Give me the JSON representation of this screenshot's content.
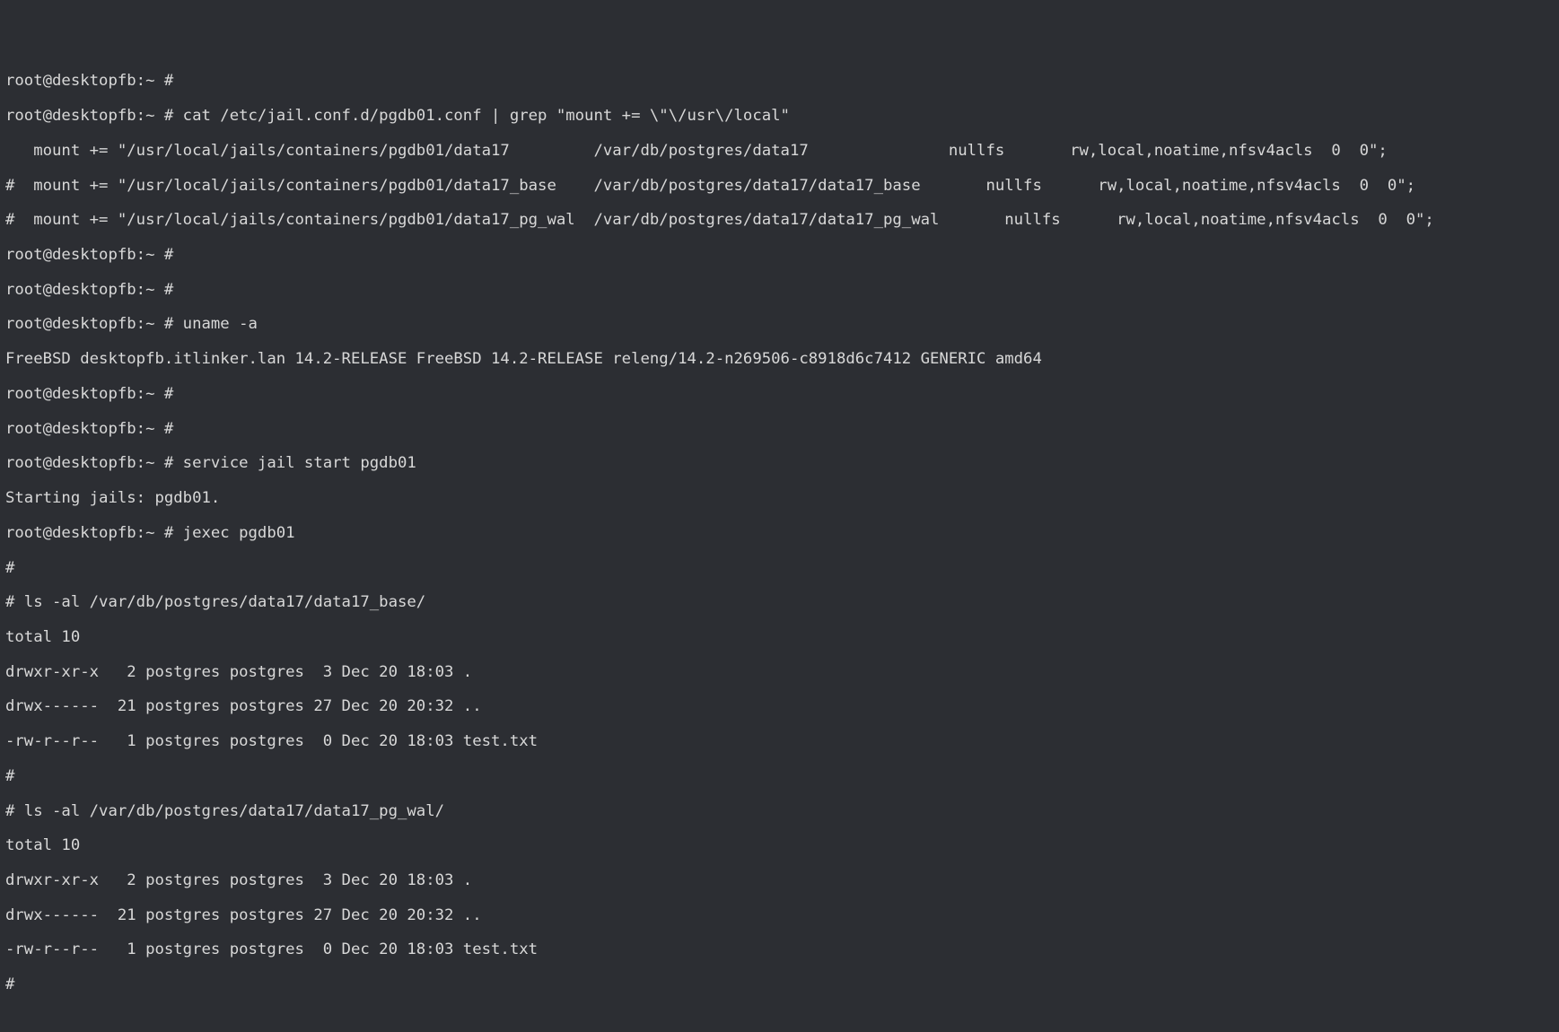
{
  "lines": [
    "root@desktopfb:~ #",
    "root@desktopfb:~ # cat /etc/jail.conf.d/pgdb01.conf | grep \"mount += \\\"\\/usr\\/local\"",
    "   mount += \"/usr/local/jails/containers/pgdb01/data17         /var/db/postgres/data17               nullfs       rw,local,noatime,nfsv4acls  0  0\";",
    "#  mount += \"/usr/local/jails/containers/pgdb01/data17_base    /var/db/postgres/data17/data17_base       nullfs      rw,local,noatime,nfsv4acls  0  0\";",
    "#  mount += \"/usr/local/jails/containers/pgdb01/data17_pg_wal  /var/db/postgres/data17/data17_pg_wal       nullfs      rw,local,noatime,nfsv4acls  0  0\";",
    "root@desktopfb:~ #",
    "root@desktopfb:~ #",
    "root@desktopfb:~ # uname -a",
    "FreeBSD desktopfb.itlinker.lan 14.2-RELEASE FreeBSD 14.2-RELEASE releng/14.2-n269506-c8918d6c7412 GENERIC amd64",
    "root@desktopfb:~ #",
    "root@desktopfb:~ #",
    "root@desktopfb:~ # service jail start pgdb01",
    "Starting jails: pgdb01.",
    "root@desktopfb:~ # jexec pgdb01",
    "#",
    "# ls -al /var/db/postgres/data17/data17_base/",
    "total 10",
    "drwxr-xr-x   2 postgres postgres  3 Dec 20 18:03 .",
    "drwx------  21 postgres postgres 27 Dec 20 20:32 ..",
    "-rw-r--r--   1 postgres postgres  0 Dec 20 18:03 test.txt",
    "#",
    "# ls -al /var/db/postgres/data17/data17_pg_wal/",
    "total 10",
    "drwxr-xr-x   2 postgres postgres  3 Dec 20 18:03 .",
    "drwx------  21 postgres postgres 27 Dec 20 20:32 ..",
    "-rw-r--r--   1 postgres postgres  0 Dec 20 18:03 test.txt",
    "#"
  ]
}
